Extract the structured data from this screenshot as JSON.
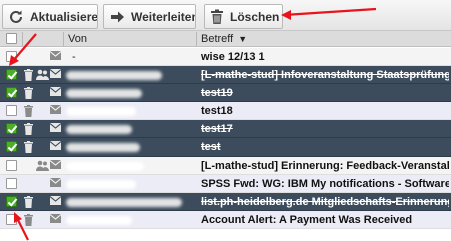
{
  "toolbar": {
    "refresh_label": "Aktualisieren",
    "forward_label": "Weiterleiten",
    "delete_label": "Löschen"
  },
  "header": {
    "from_label": "Von",
    "subject_label": "Betreff"
  },
  "messages": [
    {
      "subject": "wise 12/13 1",
      "selected": false,
      "strike": false,
      "group": false,
      "trash": false,
      "from": "-"
    },
    {
      "subject": "[L-mathe-stud] Infoveranstaltung Staatsprüfung Ma...",
      "selected": true,
      "strike": true,
      "group": true,
      "trash": true
    },
    {
      "subject": "test19",
      "selected": true,
      "strike": true,
      "group": false,
      "trash": true
    },
    {
      "subject": "test18",
      "selected": false,
      "strike": false,
      "group": false,
      "trash": true
    },
    {
      "subject": "test17",
      "selected": true,
      "strike": true,
      "group": false,
      "trash": true
    },
    {
      "subject": "test",
      "selected": true,
      "strike": true,
      "group": false,
      "trash": true
    },
    {
      "subject": "[L-mathe-stud] Erinnerung: Feedback-Veranstaltun...",
      "selected": false,
      "strike": false,
      "group": true,
      "trash": false
    },
    {
      "subject": "SPSS Fwd: WG: IBM My notifications - Software",
      "selected": false,
      "strike": false,
      "group": false,
      "trash": false
    },
    {
      "subject": "list.ph-heidelberg.de Mitgliedschafts-Erinnerung",
      "selected": true,
      "strike": true,
      "group": false,
      "trash": true
    },
    {
      "subject": "Account Alert: A Payment Was Received",
      "selected": false,
      "strike": false,
      "group": false,
      "trash": true
    }
  ],
  "colors": {
    "selected_row": "#3c4c5c",
    "checkbox_checked": "#4cae2b",
    "annotation_arrow": "#e8141c"
  }
}
